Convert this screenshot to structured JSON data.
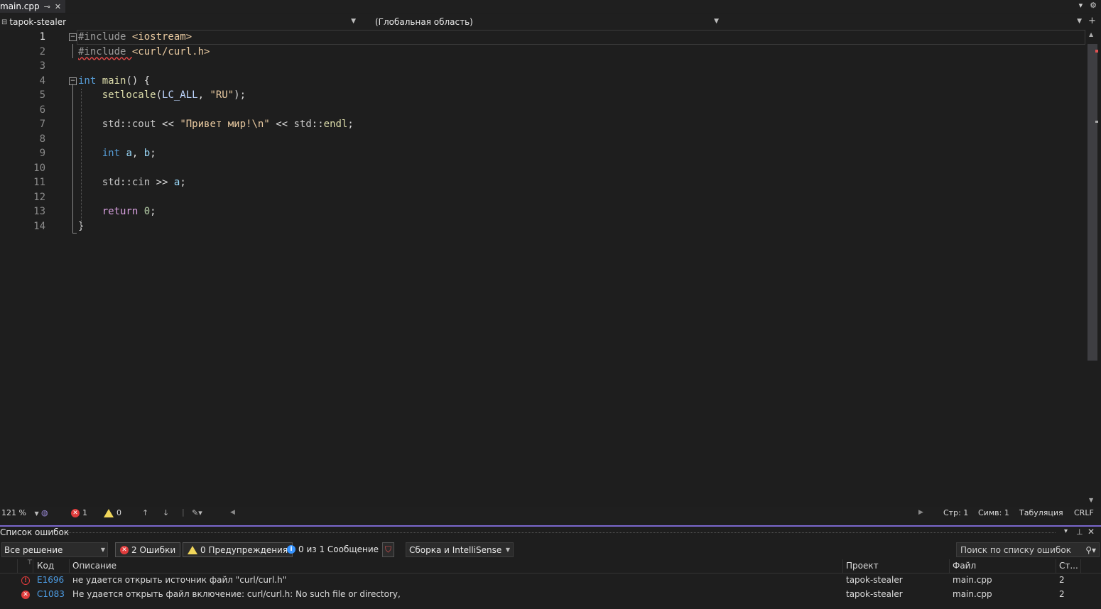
{
  "tab": {
    "title": "main.cpp",
    "pin_icon": "pin-icon",
    "close_icon": "close-icon"
  },
  "navbar": {
    "project": "tapok-stealer",
    "scope": "(Глобальная область)",
    "member": ""
  },
  "editor": {
    "line_numbers": [
      "1",
      "2",
      "3",
      "4",
      "5",
      "6",
      "7",
      "8",
      "9",
      "10",
      "11",
      "12",
      "13",
      "14"
    ],
    "lines": [
      [
        {
          "t": "#include ",
          "c": "pp"
        },
        {
          "t": "<iostream>",
          "c": "inc"
        }
      ],
      [
        {
          "t": "#include ",
          "c": "pp squig"
        },
        {
          "t": "<curl/curl.h>",
          "c": "inc"
        }
      ],
      [],
      [
        {
          "t": "int",
          "c": "kw"
        },
        {
          "t": " ",
          "c": ""
        },
        {
          "t": "main",
          "c": "fn"
        },
        {
          "t": "() {",
          "c": ""
        }
      ],
      [
        {
          "t": "    ",
          "c": ""
        },
        {
          "t": "setlocale",
          "c": "fn"
        },
        {
          "t": "(",
          "c": ""
        },
        {
          "t": "LC_ALL",
          "c": "mac"
        },
        {
          "t": ", ",
          "c": ""
        },
        {
          "t": "\"RU\"",
          "c": "str"
        },
        {
          "t": ");",
          "c": ""
        }
      ],
      [],
      [
        {
          "t": "    ",
          "c": ""
        },
        {
          "t": "std",
          "c": "ns"
        },
        {
          "t": "::",
          "c": ""
        },
        {
          "t": "cout",
          "c": "ns"
        },
        {
          "t": " << ",
          "c": ""
        },
        {
          "t": "\"Привет мир!",
          "c": "str"
        },
        {
          "t": "\\n",
          "c": "esc"
        },
        {
          "t": "\"",
          "c": "str"
        },
        {
          "t": " << ",
          "c": ""
        },
        {
          "t": "std",
          "c": "ns"
        },
        {
          "t": "::",
          "c": ""
        },
        {
          "t": "endl",
          "c": "fn"
        },
        {
          "t": ";",
          "c": ""
        }
      ],
      [],
      [
        {
          "t": "    ",
          "c": ""
        },
        {
          "t": "int",
          "c": "kw"
        },
        {
          "t": " ",
          "c": ""
        },
        {
          "t": "a",
          "c": "var"
        },
        {
          "t": ", ",
          "c": ""
        },
        {
          "t": "b",
          "c": "var"
        },
        {
          "t": ";",
          "c": ""
        }
      ],
      [],
      [
        {
          "t": "    ",
          "c": ""
        },
        {
          "t": "std",
          "c": "ns"
        },
        {
          "t": "::",
          "c": ""
        },
        {
          "t": "cin",
          "c": "ns"
        },
        {
          "t": " >> ",
          "c": ""
        },
        {
          "t": "a",
          "c": "var"
        },
        {
          "t": ";",
          "c": ""
        }
      ],
      [],
      [
        {
          "t": "    ",
          "c": ""
        },
        {
          "t": "return",
          "c": "kw2"
        },
        {
          "t": " ",
          "c": ""
        },
        {
          "t": "0",
          "c": "num"
        },
        {
          "t": ";",
          "c": ""
        }
      ],
      [
        {
          "t": "}",
          "c": ""
        }
      ]
    ]
  },
  "statusbar": {
    "zoom": "121 %",
    "errors": "1",
    "warnings": "0",
    "line": "Стр: 1",
    "col": "Симв: 1",
    "indent": "Табуляция",
    "eol": "CRLF"
  },
  "error_list": {
    "title": "Список ошибок",
    "scope_select": "Все решение",
    "errors_btn": "2 Ошибки",
    "warnings_btn": "0 Предупреждения",
    "messages_btn": "0 из 1 Сообщение",
    "build_select": "Сборка и IntelliSense",
    "search_placeholder": "Поиск по списку ошибок",
    "columns": {
      "code": "Код",
      "desc": "Описание",
      "project": "Проект",
      "file": "Файл",
      "line": "Ст..."
    },
    "rows": [
      {
        "code": "E1696",
        "desc": "не удается открыть источник файл \"curl/curl.h\"",
        "project": "tapok-stealer",
        "file": "main.cpp",
        "line": "2"
      },
      {
        "code": "C1083",
        "desc": "Не удается открыть файл включение: curl/curl.h: No such file or directory,",
        "project": "tapok-stealer",
        "file": "main.cpp",
        "line": "2"
      }
    ]
  }
}
